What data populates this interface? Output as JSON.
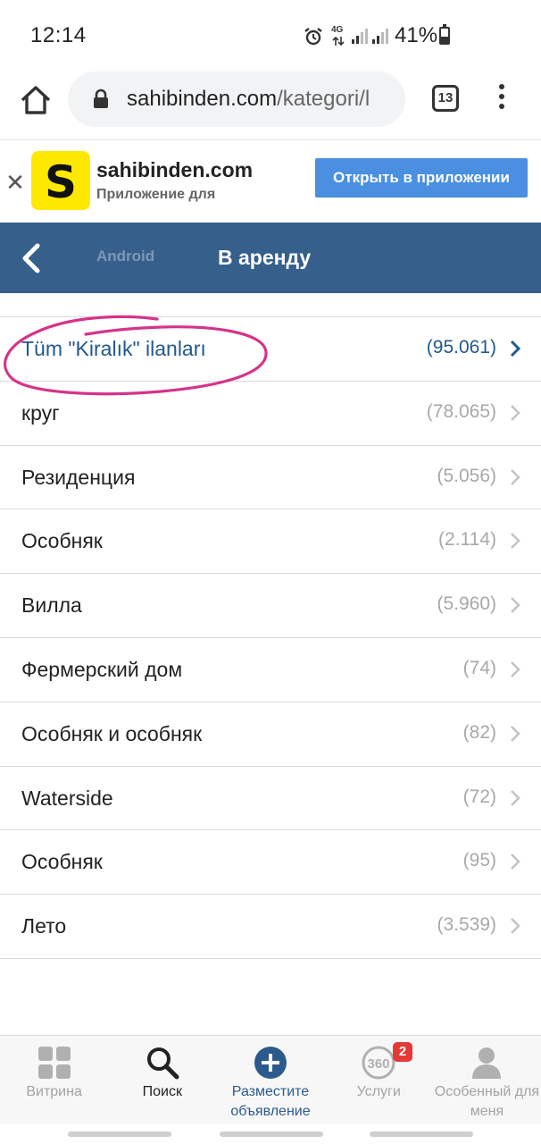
{
  "status_bar": {
    "time": "12:14",
    "network": "4G",
    "battery_percent": "41%",
    "battery_level": 0.41
  },
  "browser": {
    "url_host": "sahibinden.com",
    "url_path": "/kategori/l",
    "tab_count": "13"
  },
  "app_banner": {
    "logo_letter": "S",
    "app_name": "sahibinden.com",
    "app_subtitle": "Приложение для",
    "open_button": "Открыть в приложении"
  },
  "header": {
    "subtitle": "Android",
    "title": "В аренду"
  },
  "categories": [
    {
      "label": "Tüm \"Kiralık\" ilanları",
      "count": "(95.061)"
    },
    {
      "label": "круг",
      "count": "(78.065)"
    },
    {
      "label": "Резиденция",
      "count": "(5.056)"
    },
    {
      "label": "Особняк",
      "count": "(2.114)"
    },
    {
      "label": "Вилла",
      "count": "(5.960)"
    },
    {
      "label": "Фермерский дом",
      "count": "(74)"
    },
    {
      "label": "Особняк и особняк",
      "count": "(82)"
    },
    {
      "label": "Waterside",
      "count": "(72)"
    },
    {
      "label": "Особняк",
      "count": "(95)"
    },
    {
      "label": "Лето",
      "count": "(3.539)"
    }
  ],
  "bottom_nav": [
    {
      "label": "Витрина",
      "icon": "grid-icon"
    },
    {
      "label": "Поиск",
      "icon": "search-icon"
    },
    {
      "label": "Разместите объявление",
      "icon": "plus-circle-icon"
    },
    {
      "label": "Услуги",
      "icon": "360-icon",
      "badge": "2",
      "icon_text": "360"
    },
    {
      "label": "Особенный для меня",
      "icon": "user-icon"
    }
  ],
  "colors": {
    "header_bg": "#365f8c",
    "link_blue": "#22588e",
    "button_blue": "#4a8fe0",
    "logo_yellow": "#ffe800",
    "annotation_pink": "#d6338a"
  }
}
